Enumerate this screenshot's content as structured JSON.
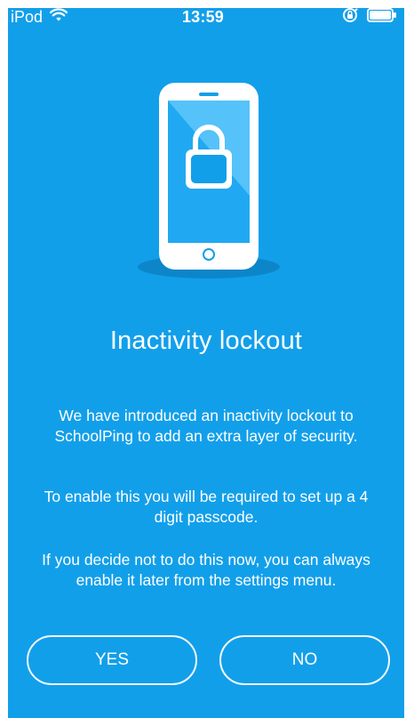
{
  "status_bar": {
    "device": "iPod",
    "time": "13:59"
  },
  "content": {
    "title": "Inactivity lockout",
    "paragraphs": [
      "We have introduced an inactivity lockout to SchoolPing to add an extra layer of security.",
      "To enable this you will be required to set up a 4 digit passcode.",
      "If you decide not to do this now, you can always enable it later from the settings menu."
    ]
  },
  "buttons": {
    "yes_label": "YES",
    "no_label": "NO"
  },
  "icons": {
    "wifi": "wifi-icon",
    "rotation_lock": "rotation-lock-icon",
    "battery": "battery-icon",
    "padlock": "padlock-icon",
    "phone": "phone-icon"
  },
  "colors": {
    "background": "#129fea",
    "phone_screen": "#20a9f2",
    "shadow": "#0d86c9",
    "white": "#ffffff"
  }
}
